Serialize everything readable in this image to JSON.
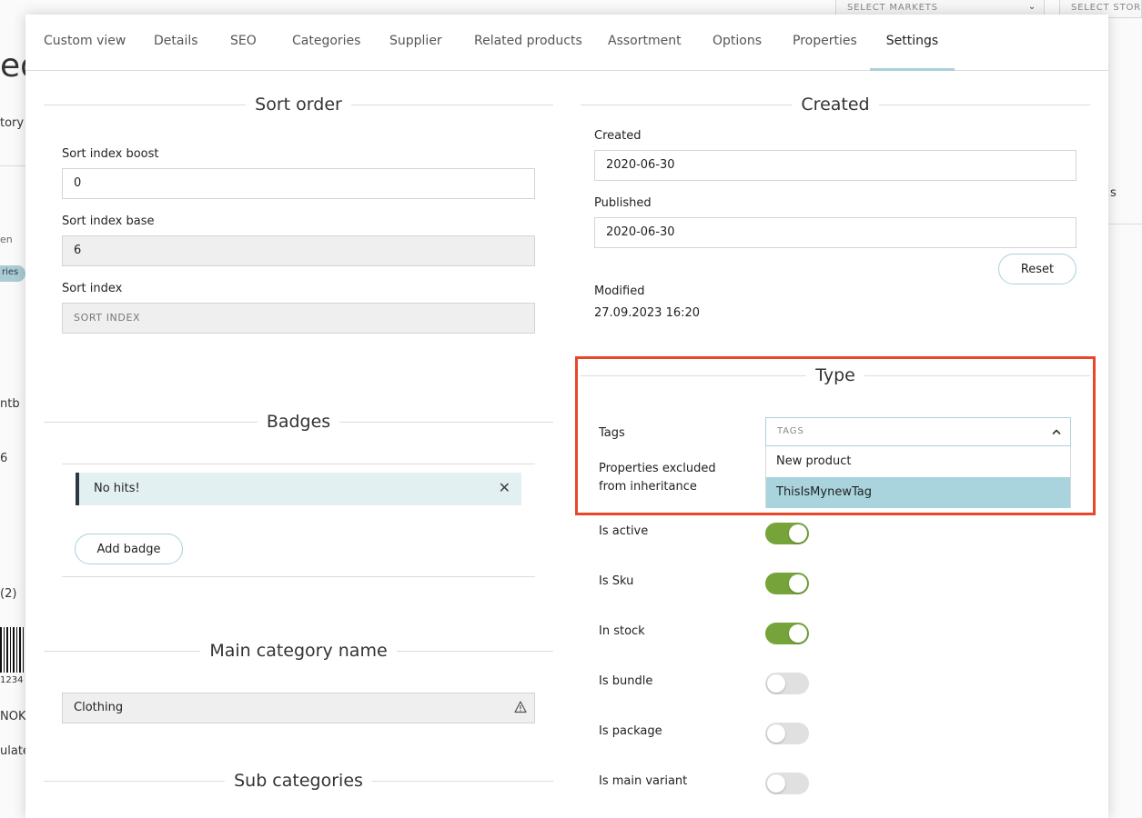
{
  "background": {
    "select_markets": "SELECT MARKETS",
    "select_store": "SELECT STOR",
    "title_fragment": "ed",
    "frag_tory": "tory",
    "frag_en": "en",
    "frag_ries": "ries",
    "frag_ntb": "ntb",
    "frag_6": "6",
    "frag_2": "(2)",
    "frag_1234": "1234",
    "frag_nok": "NOK",
    "frag_ulate": "ulate",
    "frag_s": "s"
  },
  "tabs": [
    {
      "label": "Custom view"
    },
    {
      "label": "Details"
    },
    {
      "label": "SEO"
    },
    {
      "label": "Categories"
    },
    {
      "label": "Supplier"
    },
    {
      "label": "Related products"
    },
    {
      "label": "Assortment"
    },
    {
      "label": "Options"
    },
    {
      "label": "Properties"
    },
    {
      "label": "Settings"
    }
  ],
  "sort_order": {
    "title": "Sort order",
    "boost_label": "Sort index boost",
    "boost_value": "0",
    "base_label": "Sort index base",
    "base_value": "6",
    "index_label": "Sort index",
    "index_placeholder": "SORT INDEX"
  },
  "badges": {
    "title": "Badges",
    "alert_text": "No hits!",
    "add_button": "Add badge"
  },
  "main_category": {
    "title": "Main category name",
    "value": "Clothing"
  },
  "sub_categories": {
    "title": "Sub categories"
  },
  "created": {
    "title": "Created",
    "created_label": "Created",
    "created_value": "2020-06-30",
    "published_label": "Published",
    "published_value": "2020-06-30",
    "reset_button": "Reset",
    "modified_label": "Modified",
    "modified_value": "27.09.2023 16:20"
  },
  "type": {
    "title": "Type",
    "tags_label": "Tags",
    "tags_placeholder": "TAGS",
    "tag_options": [
      "New product",
      "ThisIsMynewTag"
    ],
    "selected_tag": "ThisIsMynewTag",
    "excluded_label_line1": "Properties excluded",
    "excluded_label_line2": "from inheritance"
  },
  "toggles": [
    {
      "label": "Is active",
      "on": true
    },
    {
      "label": "Is Sku",
      "on": true
    },
    {
      "label": "In stock",
      "on": true
    },
    {
      "label": "Is bundle",
      "on": false
    },
    {
      "label": "Is package",
      "on": false
    },
    {
      "label": "Is main variant",
      "on": false
    }
  ],
  "colors": {
    "accent": "#a9d1d9",
    "toggle_on": "#76a33a",
    "highlight": "#e8472a",
    "selected_option": "#a9d4dd"
  }
}
